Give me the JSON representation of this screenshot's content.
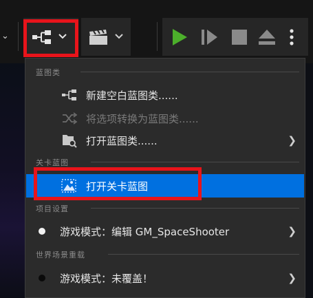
{
  "toolbar": {
    "blueprint_button_icon": "blueprint-icon",
    "cinematics_button_icon": "clapperboard-icon",
    "play_icon": "play-icon",
    "advance_frame_icon": "step-forward-icon",
    "stop_icon": "stop-icon",
    "eject_icon": "eject-icon",
    "more_icon": "more-vertical-icon",
    "colors": {
      "play": "#4caf2b",
      "highlight": "#e8141b"
    }
  },
  "menu": {
    "sections": {
      "blueprint_classes": "蓝图类",
      "level_blueprint": "关卡蓝图",
      "project_settings": "项目设置",
      "world_override": "世界场景重载"
    },
    "items": {
      "new_empty_blueprint": "新建空白蓝图类......",
      "convert_selection": "将选项转换为蓝图类......",
      "open_blueprint_class": "打开蓝图类......",
      "open_level_blueprint": "打开关卡蓝图",
      "game_mode_edit": "游戏模式：编辑 GM_SpaceShooter",
      "game_mode_unset": "游戏模式：未覆盖！"
    },
    "selected_color": "#0070e0"
  }
}
